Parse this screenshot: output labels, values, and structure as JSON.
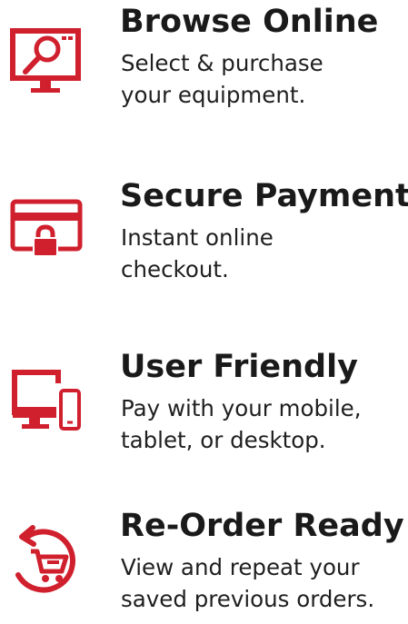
{
  "colors": {
    "accent": "#d0202e",
    "text": "#1a1a1a"
  },
  "features": [
    {
      "icon": "monitor-search-icon",
      "title": "Browse Online",
      "desc_line1": "Select & purchase",
      "desc_line2": "your equipment."
    },
    {
      "icon": "card-lock-icon",
      "title": "Secure Payment",
      "desc_line1": "Instant online",
      "desc_line2": "checkout."
    },
    {
      "icon": "devices-icon",
      "title": "User Friendly",
      "desc_line1": "Pay with your mobile,",
      "desc_line2": "tablet, or desktop."
    },
    {
      "icon": "cart-reorder-icon",
      "title": "Re-Order Ready",
      "desc_line1": "View and repeat your",
      "desc_line2": "saved previous orders."
    }
  ]
}
